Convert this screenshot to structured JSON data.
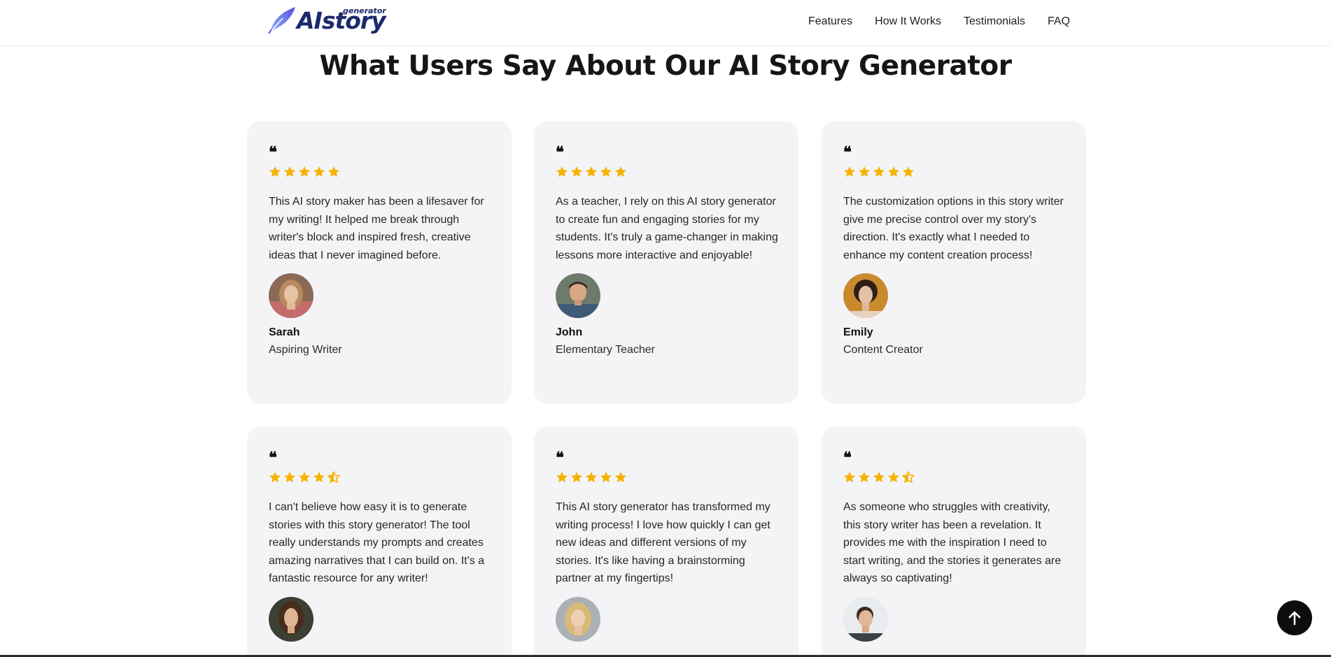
{
  "header": {
    "logo_text": "AIstory",
    "logo_sub": "generator",
    "nav": [
      "Features",
      "How It Works",
      "Testimonials",
      "FAQ"
    ]
  },
  "section": {
    "title": "What Users Say About Our AI Story Generator"
  },
  "colors": {
    "star": "#f5b301",
    "card_bg": "#f4f4f6",
    "brand": "#1c2a6b"
  },
  "testimonials": [
    {
      "rating": 5,
      "text": "This AI story maker has been a lifesaver for my writing! It helped me break through writer's block and inspired fresh, creative ideas that I never imagined before.",
      "name": "Sarah",
      "role": "Aspiring Writer"
    },
    {
      "rating": 5,
      "text": "As a teacher, I rely on this AI story generator to create fun and engaging stories for my students. It's truly a game-changer in making lessons more interactive and enjoyable!",
      "name": "John",
      "role": "Elementary Teacher"
    },
    {
      "rating": 5,
      "text": "The customization options in this story writer give me precise control over my story's direction. It's exactly what I needed to enhance my content creation process!",
      "name": "Emily",
      "role": "Content Creator"
    },
    {
      "rating": 4.5,
      "text": "I can't believe how easy it is to generate stories with this story generator! The tool really understands my prompts and creates amazing narratives that I can build on. It's a fantastic resource for any writer!",
      "name": "",
      "role": ""
    },
    {
      "rating": 5,
      "text": "This AI story generator has transformed my writing process! I love how quickly I can get new ideas and different versions of my stories. It's like having a brainstorming partner at my fingertips!",
      "name": "",
      "role": ""
    },
    {
      "rating": 4.5,
      "text": "As someone who struggles with creativity, this story writer has been a revelation. It provides me with the inspiration I need to start writing, and the stories it generates are always so captivating!",
      "name": "",
      "role": ""
    }
  ],
  "scroll_top_icon": "arrow-up-icon"
}
